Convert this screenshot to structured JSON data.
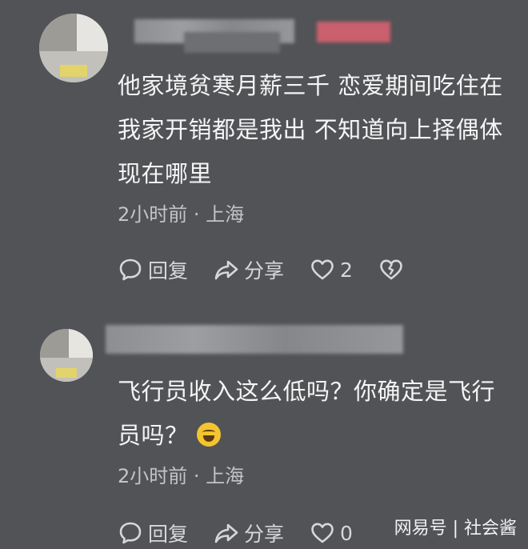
{
  "comments": [
    {
      "text_lines": [
        "他家境贫寒月薪三千  恋爱期间吃住在",
        "我家开销都是我出  不知道向上择偶体",
        "现在哪里"
      ],
      "meta": "2小时前 · 上海",
      "actions": {
        "reply": "回复",
        "share": "分享",
        "likes": "2"
      }
    },
    {
      "text_lines": [
        "飞行员收入这么低吗？你确定是飞行",
        "员吗？"
      ],
      "meta": "2小时前 · 上海",
      "actions": {
        "reply": "回复",
        "share": "分享",
        "likes": "0"
      }
    }
  ],
  "watermark": "网易号 | 社会酱",
  "colors": {
    "background": "#515356",
    "text": "#f5f5f5",
    "meta": "#c3c4c6"
  }
}
